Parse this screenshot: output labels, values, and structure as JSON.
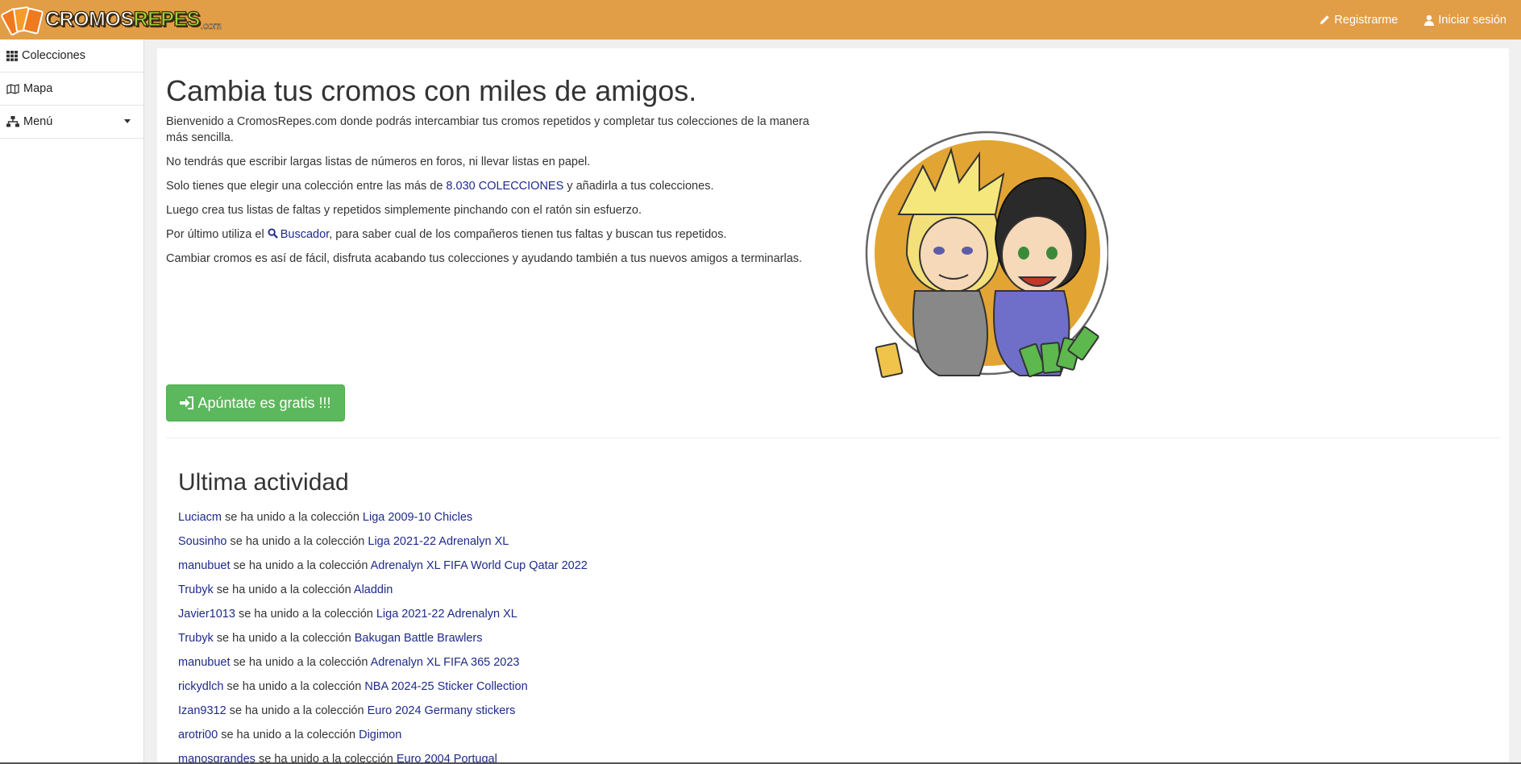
{
  "brand": {
    "logo_text_1": "CROMOS",
    "logo_text_2": "REPES",
    "logo_suffix": ".com"
  },
  "nav": {
    "register_label": "Registrarme",
    "login_label": "Iniciar sesión"
  },
  "sidebar": {
    "items": [
      {
        "label": "Colecciones",
        "icon": "grid-icon"
      },
      {
        "label": "Mapa",
        "icon": "map-icon"
      },
      {
        "label": "Menú",
        "icon": "sitemap-icon"
      }
    ]
  },
  "main": {
    "title": "Cambia tus cromos con miles de amigos.",
    "intro": {
      "p1": "Bienvenido a CromosRepes.com donde podrás intercambiar tus cromos repetidos y completar tus colecciones de la manera más sencilla.",
      "p2": "No tendrás que escribir largas listas de números en foros, ni llevar listas en papel.",
      "p3_before": "Solo tienes que elegir una colección entre las más de ",
      "p3_link": "8.030 COLECCIONES",
      "p3_after": " y añadirla a tus colecciones.",
      "p4": "Luego crea tus listas de faltas y repetidos simplemente pinchando con el ratón sin esfuerzo.",
      "p5_before": "Por último utiliza el ",
      "p5_link": "Buscador",
      "p5_after": ", para saber cual de los compañeros tienen tus faltas y buscan tus repetidos.",
      "p6": "Cambiar cromos es así de fácil, disfruta acabando tus colecciones y ayudando también a tus nuevos amigos a terminarlas."
    },
    "cta_label": "Apúntate es gratis !!!",
    "activity_title": "Ultima actividad",
    "activity_joined_text": " se ha unido a la colección ",
    "activity": [
      {
        "user": "Luciacm",
        "collection": "Liga 2009-10 Chicles"
      },
      {
        "user": "Sousinho",
        "collection": "Liga 2021-22 Adrenalyn XL"
      },
      {
        "user": "manubuet",
        "collection": "Adrenalyn XL FIFA World Cup Qatar 2022"
      },
      {
        "user": "Trubyk",
        "collection": "Aladdin"
      },
      {
        "user": "Javier1013",
        "collection": "Liga 2021-22 Adrenalyn XL"
      },
      {
        "user": "Trubyk",
        "collection": "Bakugan Battle Brawlers"
      },
      {
        "user": "manubuet",
        "collection": "Adrenalyn XL FIFA 365 2023"
      },
      {
        "user": "rickydlch",
        "collection": "NBA 2024-25 Sticker Collection"
      },
      {
        "user": "Izan9312",
        "collection": "Euro 2024 Germany stickers"
      },
      {
        "user": "arotri00",
        "collection": "Digimon"
      },
      {
        "user": "manosgrandes",
        "collection": "Euro 2004 Portugal"
      }
    ]
  },
  "colors": {
    "navbar": "#e29d47",
    "link": "#1f2a8a",
    "cta": "#5cb85c"
  }
}
